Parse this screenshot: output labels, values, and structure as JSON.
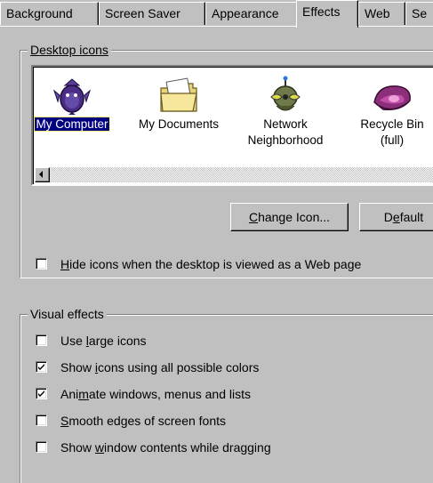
{
  "tabs": [
    {
      "label": "Background"
    },
    {
      "label": "Screen Saver"
    },
    {
      "label": "Appearance"
    },
    {
      "label": "Effects",
      "active": true
    },
    {
      "label": "Web"
    },
    {
      "label": "Se"
    }
  ],
  "desktop_icons": {
    "legend": "Desktop icons",
    "items": [
      {
        "label_lines": [
          "My Computer"
        ],
        "icon": "my-computer-icon",
        "selected": true
      },
      {
        "label_lines": [
          "My Documents"
        ],
        "icon": "my-documents-folder-icon"
      },
      {
        "label_lines": [
          "Network",
          "Neighborhood"
        ],
        "icon": "network-neighborhood-icon"
      },
      {
        "label_lines": [
          "Recycle Bin",
          "(full)"
        ],
        "icon": "recycle-bin-full-icon"
      }
    ],
    "change_icon_button": {
      "pre": "",
      "key": "C",
      "post": "hange Icon..."
    },
    "default_button": {
      "pre": "D",
      "key": "e",
      "post": "fault"
    },
    "hide_icons": {
      "pre": "",
      "key": "H",
      "post": "ide icons when the desktop is viewed as a Web page",
      "checked": false
    }
  },
  "visual_effects": {
    "legend": "Visual effects",
    "options": [
      {
        "pre": "Use ",
        "key": "l",
        "post": "arge icons",
        "checked": false
      },
      {
        "pre": "Show ",
        "key": "i",
        "post": "cons using all possible colors",
        "checked": true
      },
      {
        "pre": "Ani",
        "key": "m",
        "post": "ate windows, menus and lists",
        "checked": true
      },
      {
        "pre": "",
        "key": "S",
        "post": "mooth edges of screen fonts",
        "checked": false
      },
      {
        "pre": "Show ",
        "key": "w",
        "post": "indow contents while dragging",
        "checked": false
      }
    ]
  }
}
